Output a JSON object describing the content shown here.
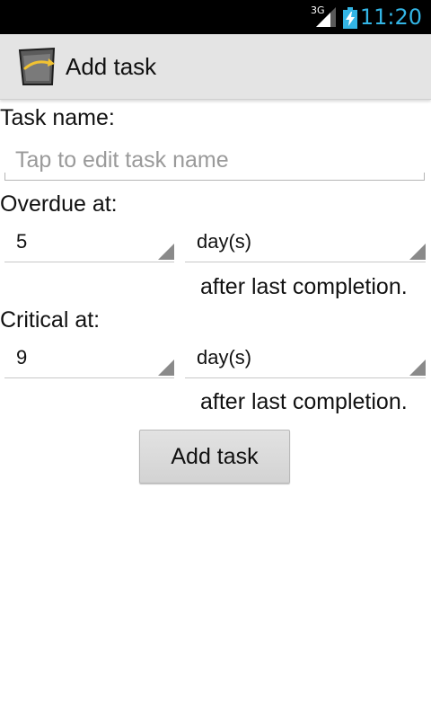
{
  "status_bar": {
    "network": "3G",
    "time": "11:20",
    "time_color": "#33b5e5",
    "icons": [
      "signal-icon",
      "battery-charging-icon"
    ]
  },
  "action_bar": {
    "title": "Add task",
    "icon": "task-app-icon"
  },
  "form": {
    "task_name_label": "Task name:",
    "task_name_value": "",
    "task_name_placeholder": "Tap to edit task name",
    "overdue_label": "Overdue at:",
    "overdue_amount": "5",
    "overdue_unit": "day(s)",
    "overdue_suffix": "after last completion.",
    "critical_label": "Critical at:",
    "critical_amount": "9",
    "critical_unit": "day(s)",
    "critical_suffix": "after last completion.",
    "submit_label": "Add task"
  }
}
